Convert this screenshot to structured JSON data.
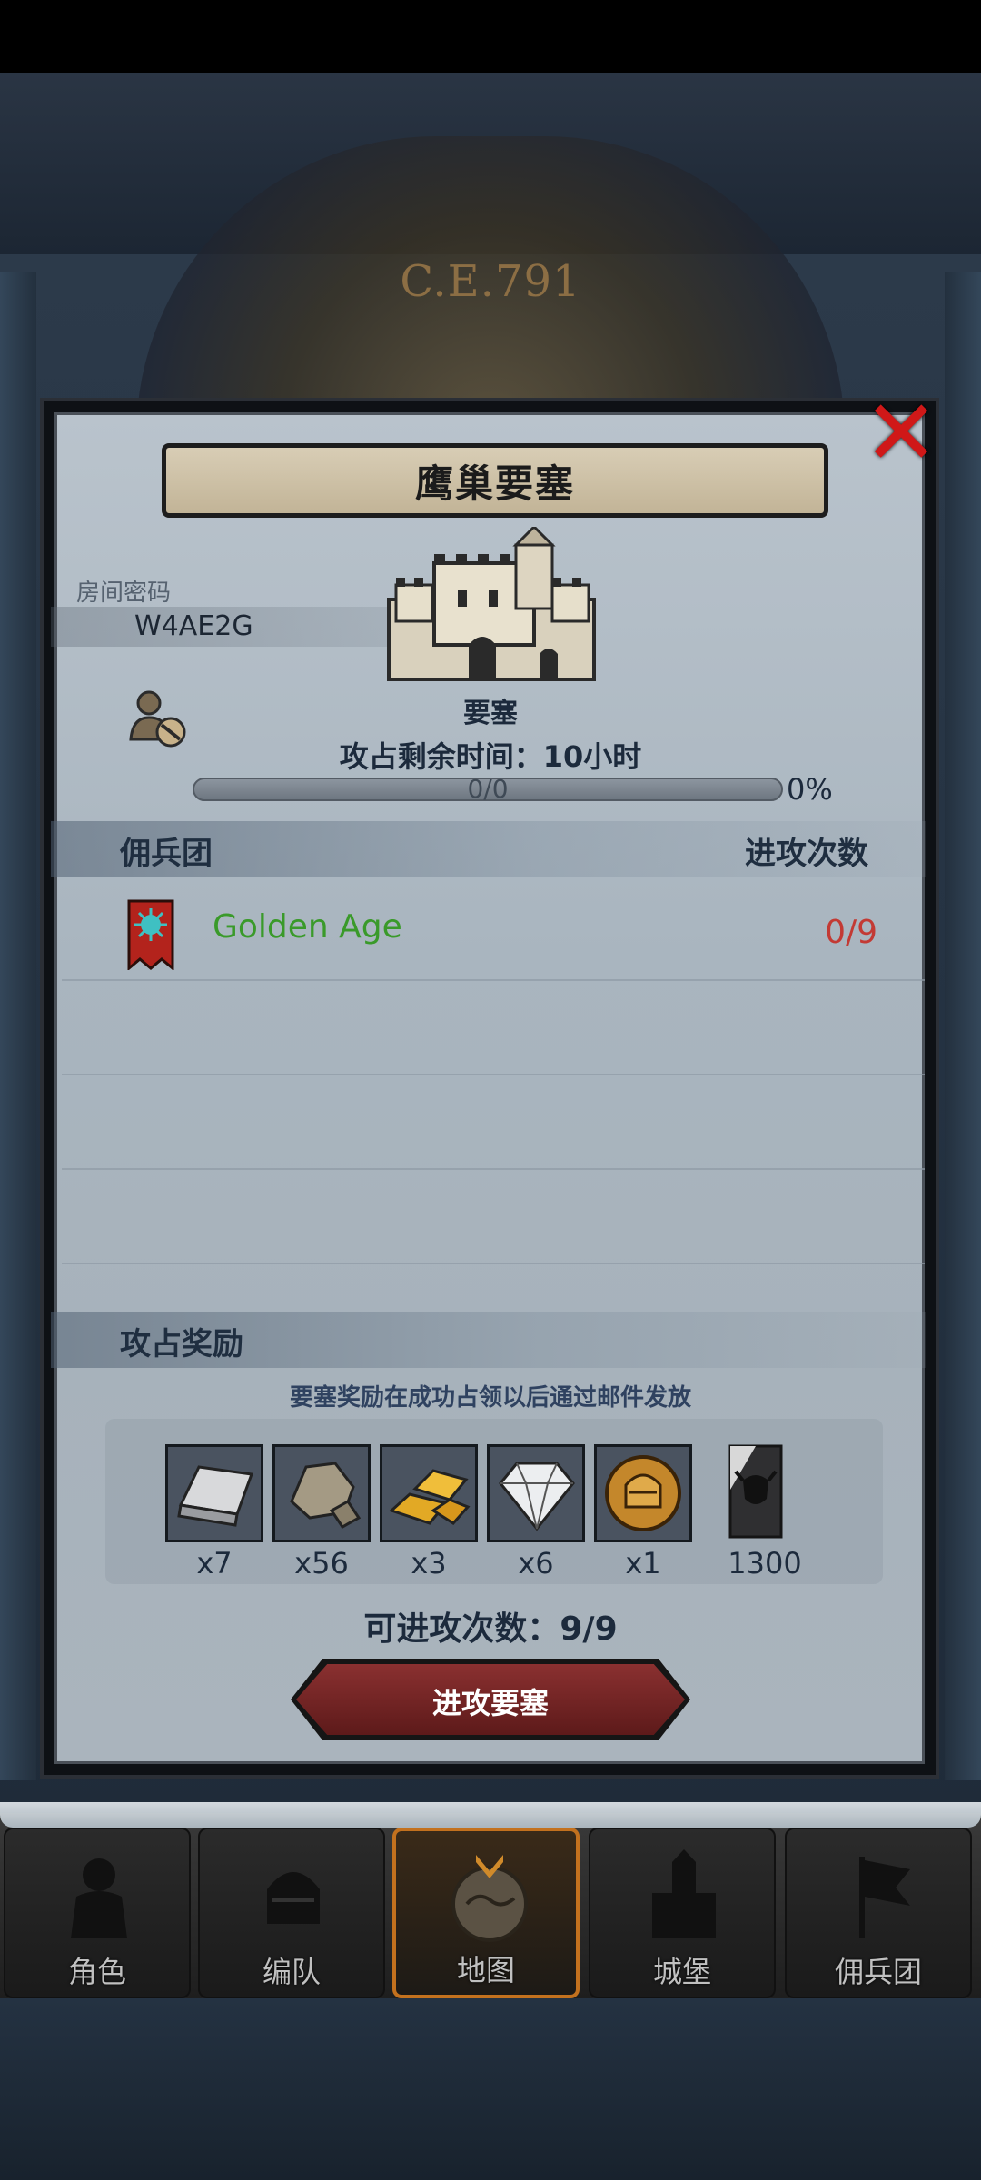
{
  "header": {
    "era": "C.E.791"
  },
  "dialog": {
    "title": "鹰巢要塞",
    "close_icon": "close-x-icon",
    "room_password_label": "房间密码",
    "room_password": "W4AE2G",
    "fortress_label": "要塞",
    "remaining_time": "攻占剩余时间：10小时",
    "progress": {
      "text": "0/0",
      "percent_text": "0%",
      "value": 0
    },
    "mercenary_section": {
      "title": "佣兵团",
      "attacks_header": "进攻次数",
      "rows": [
        {
          "name": "Golden Age",
          "attacks": "0/9",
          "icon": "guild-banner-icon"
        }
      ]
    },
    "rewards_section": {
      "title": "攻占奖励",
      "note": "要塞奖励在成功占领以后通过邮件发放",
      "items": [
        {
          "icon": "iron-bar-icon",
          "qty": "x7"
        },
        {
          "icon": "stone-ore-icon",
          "qty": "x56"
        },
        {
          "icon": "gold-bars-icon",
          "qty": "x3"
        },
        {
          "icon": "diamond-icon",
          "qty": "x6"
        },
        {
          "icon": "knight-helmet-medal-icon",
          "qty": "x1"
        },
        {
          "icon": "banner-bull-icon",
          "qty": "1300"
        }
      ]
    },
    "attack_left": "可进攻次数：9/9",
    "attack_button": "进攻要塞"
  },
  "nav": {
    "tabs": [
      {
        "label": "角色",
        "icon": "knight-icon"
      },
      {
        "label": "编队",
        "icon": "helmet-icon"
      },
      {
        "label": "地图",
        "icon": "map-compass-icon",
        "active": true
      },
      {
        "label": "城堡",
        "icon": "castle-icon"
      },
      {
        "label": "佣兵团",
        "icon": "guild-flag-icon"
      }
    ]
  },
  "colors": {
    "guild_name": "#3a9a2a",
    "attack_count": "#c33a34",
    "button": "#6e2222",
    "nav_active_border": "#c3711e"
  }
}
